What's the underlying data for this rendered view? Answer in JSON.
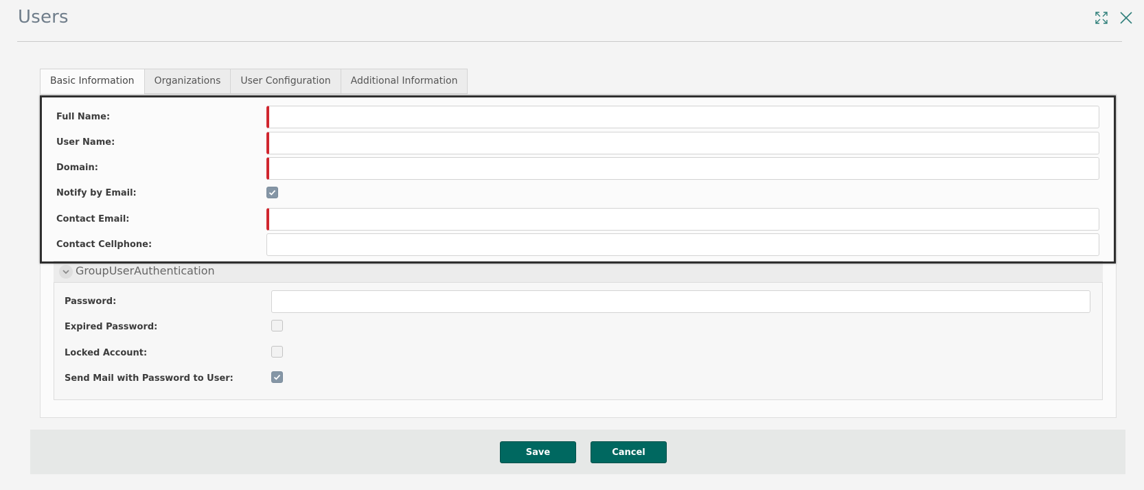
{
  "dialog": {
    "title": "Users"
  },
  "tabs": [
    {
      "label": "Basic Information",
      "active": true
    },
    {
      "label": "Organizations",
      "active": false
    },
    {
      "label": "User Configuration",
      "active": false
    },
    {
      "label": "Additional Information",
      "active": false
    }
  ],
  "basic": {
    "full_name": {
      "label": "Full Name:",
      "value": "",
      "required": true
    },
    "user_name": {
      "label": "User Name:",
      "value": "",
      "required": true
    },
    "domain": {
      "label": "Domain:",
      "value": "",
      "required": true
    },
    "notify_email": {
      "label": "Notify by Email:",
      "checked": true
    },
    "contact_email": {
      "label": "Contact Email:",
      "value": "",
      "required": true
    },
    "contact_cellphone": {
      "label": "Contact Cellphone:",
      "value": "",
      "required": false
    }
  },
  "group_auth": {
    "title": "GroupUserAuthentication",
    "password": {
      "label": "Password:",
      "value": ""
    },
    "expired_password": {
      "label": "Expired Password:",
      "checked": false
    },
    "locked_account": {
      "label": "Locked Account:",
      "checked": false
    },
    "send_mail": {
      "label": "Send Mail with Password to User:",
      "checked": true
    }
  },
  "footer": {
    "save_label": "Save",
    "cancel_label": "Cancel"
  },
  "colors": {
    "accent": "#006860",
    "required": "#d0262f",
    "checkbox_checked": "#8596a6"
  }
}
